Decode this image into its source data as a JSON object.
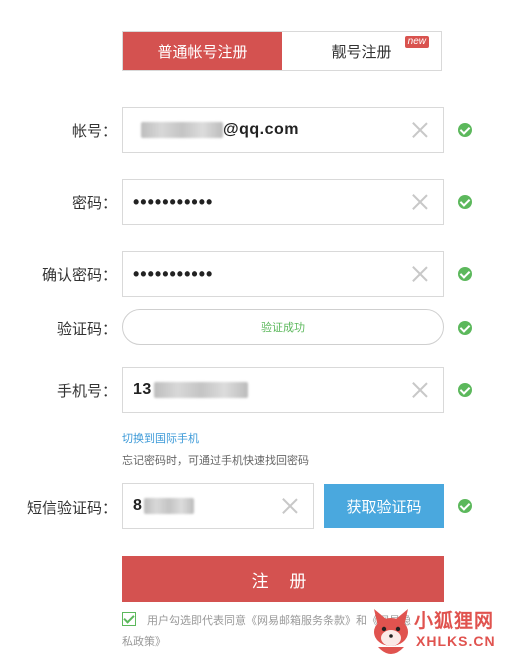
{
  "tabs": {
    "normal": "普通帐号注册",
    "premium": "靓号注册",
    "premium_badge": "new"
  },
  "account": {
    "label": "帐号：",
    "suffix": "@qq.com"
  },
  "password": {
    "label": "密码：",
    "value": "•••••••••••"
  },
  "confirm_password": {
    "label": "确认密码：",
    "value": "•••••••••••"
  },
  "captcha": {
    "label": "验证码：",
    "status": "验证成功"
  },
  "phone": {
    "label": "手机号：",
    "prefix": "13"
  },
  "intl_link": "切换到国际手机",
  "hint": "忘记密码时，可通过手机快速找回密码",
  "sms": {
    "label": "短信验证码：",
    "prefix": "8",
    "button": "获取验证码"
  },
  "register_button": "注 册",
  "agreement": {
    "line1": "用户勾选即代表同意《网易邮箱服务条款》和《网易隐",
    "line2": "私政策》"
  },
  "watermark": {
    "cn": "小狐狸网",
    "en": "XHLKS.CN"
  },
  "colors": {
    "primary_red": "#d45250",
    "blue": "#4aa8de",
    "success_green": "#5cb85c",
    "link_blue": "#3d9ad8"
  }
}
